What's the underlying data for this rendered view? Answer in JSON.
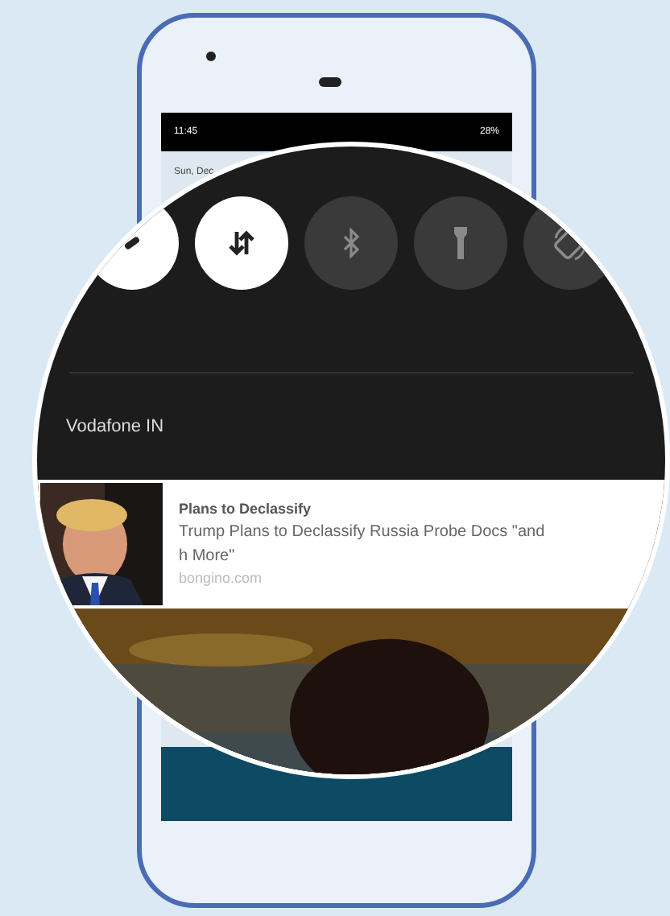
{
  "status_bar": {
    "time": "11:45",
    "battery": "28%"
  },
  "date": "Sun, Dec",
  "quick_settings": [
    {
      "kind": "generic",
      "on": true
    },
    {
      "kind": "data",
      "on": true
    },
    {
      "kind": "bluetooth",
      "on": false
    },
    {
      "kind": "flashlight",
      "on": false
    },
    {
      "kind": "rotate",
      "on": false
    }
  ],
  "carrier": "Vodafone IN",
  "notification": {
    "title": "Plans to Declassify",
    "lines": [
      "Trump Plans to Declassify Russia Probe Docs \"and",
      "h More\""
    ],
    "source": "bongino.com"
  }
}
